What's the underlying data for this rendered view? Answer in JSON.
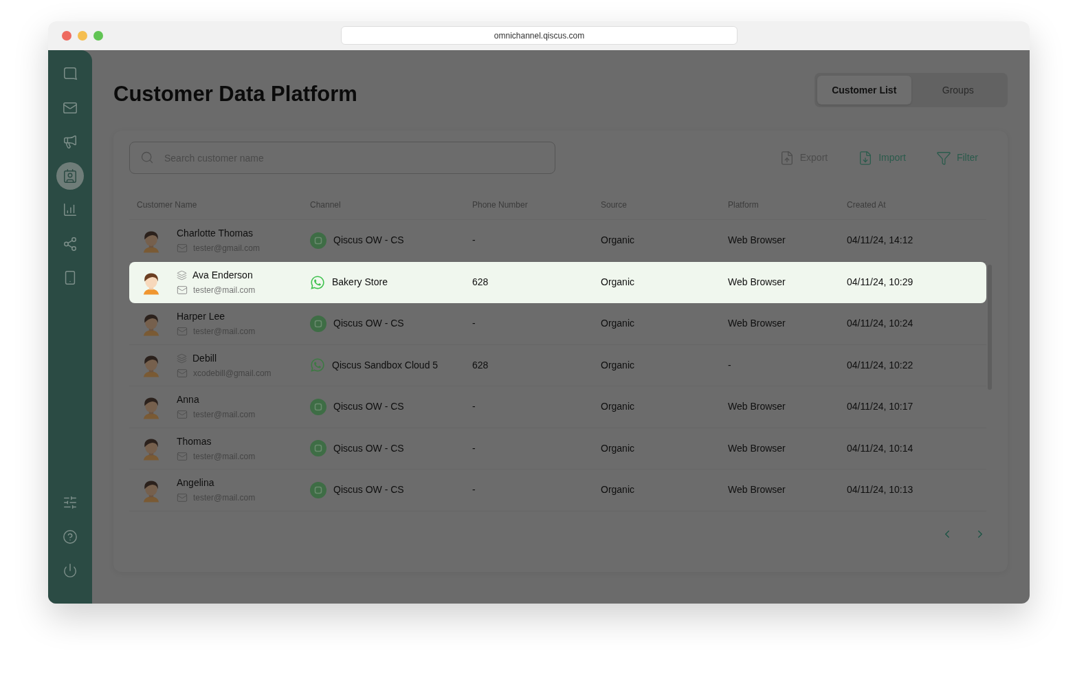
{
  "browser": {
    "url": "omnichannel.qiscus.com"
  },
  "sidebar": {
    "items": [
      {
        "selected": false
      },
      {
        "selected": false
      },
      {
        "selected": false
      },
      {
        "selected": true
      },
      {
        "selected": false
      },
      {
        "selected": false
      },
      {
        "selected": false
      }
    ],
    "bottom_items": [
      {
        "selected": false
      },
      {
        "selected": false
      },
      {
        "selected": false
      }
    ]
  },
  "page_title": "Customer Data Platform",
  "tabs": [
    {
      "label": "Customer List",
      "selected": true
    },
    {
      "label": "Groups",
      "selected": false
    }
  ],
  "search": {
    "placeholder": "Search customer name"
  },
  "actions": [
    {
      "kind": "export",
      "label": "Export",
      "disabled": true
    },
    {
      "kind": "import",
      "label": "Import",
      "disabled": false
    },
    {
      "kind": "filter",
      "label": "Filter",
      "disabled": false
    }
  ],
  "table": {
    "columns": [
      "Customer Name",
      "Channel",
      "Phone Number",
      "Source",
      "Platform",
      "Created At"
    ],
    "rows": [
      {
        "name": "Charlotte Thomas",
        "email": "tester@gmail.com",
        "in_group": false,
        "channel": {
          "kind": "qiscus",
          "name": "Qiscus OW - CS"
        },
        "phone": "-",
        "source": "Organic",
        "platform": "Web Browser",
        "created_at": "04/11/24, 14:12",
        "selected": false
      },
      {
        "name": "Ava Enderson",
        "email": "tester@mail.com",
        "in_group": true,
        "channel": {
          "kind": "whatsapp",
          "name": "Bakery Store"
        },
        "phone": "628",
        "source": "Organic",
        "platform": "Web Browser",
        "created_at": "04/11/24, 10:29",
        "selected": true
      },
      {
        "name": "Harper Lee",
        "email": "tester@mail.com",
        "in_group": false,
        "channel": {
          "kind": "qiscus",
          "name": "Qiscus OW - CS"
        },
        "phone": "-",
        "source": "Organic",
        "platform": "Web Browser",
        "created_at": "04/11/24, 10:24",
        "selected": false
      },
      {
        "name": "Debill",
        "email": "xcodebill@gmail.com",
        "in_group": true,
        "channel": {
          "kind": "whatsapp",
          "name": "Qiscus Sandbox Cloud 5"
        },
        "phone": "628",
        "source": "Organic",
        "platform": "-",
        "created_at": "04/11/24, 10:22",
        "selected": false
      },
      {
        "name": "Anna",
        "email": "tester@mail.com",
        "in_group": false,
        "channel": {
          "kind": "qiscus",
          "name": "Qiscus OW - CS"
        },
        "phone": "-",
        "source": "Organic",
        "platform": "Web Browser",
        "created_at": "04/11/24, 10:17",
        "selected": false
      },
      {
        "name": "Thomas",
        "email": "tester@mail.com",
        "in_group": false,
        "channel": {
          "kind": "qiscus",
          "name": "Qiscus OW - CS"
        },
        "phone": "-",
        "source": "Organic",
        "platform": "Web Browser",
        "created_at": "04/11/24, 10:14",
        "selected": false
      },
      {
        "name": "Angelina",
        "email": "tester@mail.com",
        "in_group": false,
        "channel": {
          "kind": "qiscus",
          "name": "Qiscus OW - CS"
        },
        "phone": "-",
        "source": "Organic",
        "platform": "Web Browser",
        "created_at": "04/11/24, 10:13",
        "selected": false
      }
    ]
  }
}
